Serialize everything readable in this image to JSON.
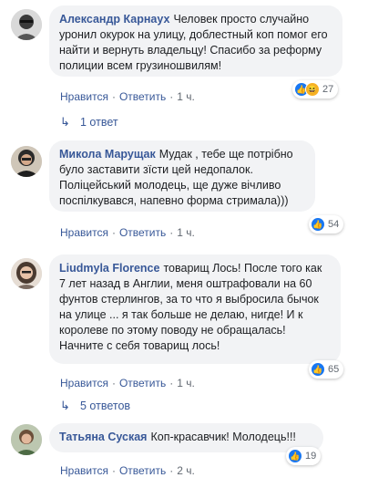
{
  "comments": [
    {
      "author": "Александр Карнаух",
      "text": "Человек просто случайно уронил окурок на улицу, доблестный коп помог его найти и вернуть владельцу! Спасибо за реформу полиции всем грузиношвилям!",
      "reaction_count": "27",
      "reactions": [
        "like-icon",
        "haha-icon"
      ],
      "like_label": "Нравится",
      "reply_label": "Ответить",
      "time": "1 ч.",
      "replies_label": "1 ответ"
    },
    {
      "author": "Микола Марущак",
      "text": "Мудак , тебе ще потрібно було заставити зїсти цей недопалок. Поліцейський молодець, ще дуже вічливо поспілкувався, напевно форма стримала)))",
      "reaction_count": "54",
      "reactions": [
        "like-icon"
      ],
      "like_label": "Нравится",
      "reply_label": "Ответить",
      "time": "1 ч."
    },
    {
      "author": "Liudmyla Florence",
      "text": "товарищ Лось! После того как 7 лет назад в Англии, меня оштрафовали на 60 фунтов стерлингов, за то что я выбросила бычок на улице ... я так больше не делаю, нигде! И к королеве по этому поводу не обращалась! Начните с себя товарищ лось!",
      "reaction_count": "65",
      "reactions": [
        "like-icon"
      ],
      "like_label": "Нравится",
      "reply_label": "Ответить",
      "time": "1 ч.",
      "replies_label": "5 ответов"
    },
    {
      "author": "Татьяна Суская",
      "text": "Коп-красавчик! Молодець!!!",
      "reaction_count": "19",
      "reactions": [
        "like-icon"
      ],
      "like_label": "Нравится",
      "reply_label": "Ответить",
      "time": "2 ч."
    }
  ],
  "colors": {
    "author": "#385898",
    "bubble": "#f2f3f5",
    "like": "#1877f2",
    "haha": "#f7b125",
    "meta": "#606770"
  }
}
